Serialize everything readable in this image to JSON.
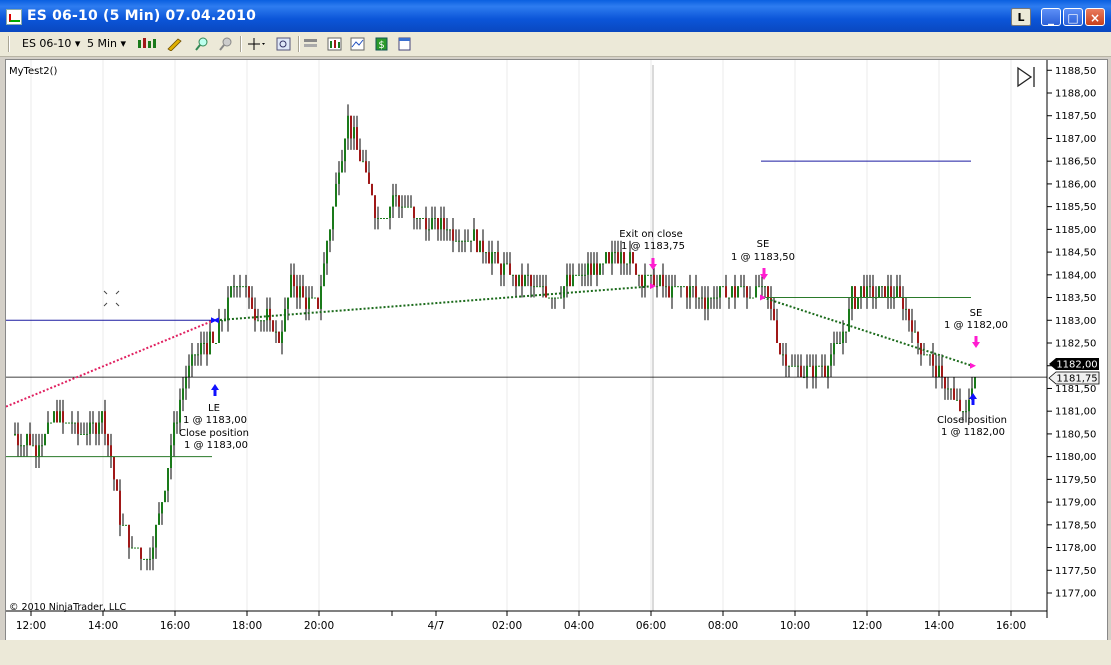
{
  "window": {
    "title": "ES 06-10 (5 Min)  07.04.2010",
    "btn_l": "L"
  },
  "toolbar": {
    "instrument": "ES 06-10",
    "interval": "5 Min"
  },
  "chart": {
    "indicator_label": "MyTest2()",
    "copyright": "© 2010 NinjaTrader, LLC",
    "y_ticks": [
      "1188,50",
      "1188,00",
      "1187,50",
      "1187,00",
      "1186,50",
      "1186,00",
      "1185,50",
      "1185,00",
      "1184,50",
      "1184,00",
      "1183,50",
      "1183,00",
      "1182,50",
      "1182,00",
      "1181,50",
      "1181,00",
      "1180,50",
      "1180,00",
      "1179,50",
      "1179,00",
      "1178,50",
      "1178,00",
      "1177,50",
      "1177,00"
    ],
    "x_ticks": [
      "12:00",
      "14:00",
      "16:00",
      "18:00",
      "20:00",
      "4/7",
      "02:00",
      "04:00",
      "06:00",
      "08:00",
      "10:00",
      "12:00",
      "14:00",
      "16:00"
    ],
    "price_flag_current": "1182,00",
    "price_flag_line": "1181,75",
    "annotations": {
      "le": "LE",
      "le_price": "1 @ 1183,00",
      "close_pos1": "Close position",
      "close_pos1_price": "1 @ 1183,00",
      "exit_close": "Exit on close",
      "exit_close_price": "1 @ 1183,75",
      "se1": "SE",
      "se1_price": "1 @ 1183,50",
      "se2": "SE",
      "se2_price": "1 @ 1182,00",
      "close_pos2": "Close position",
      "close_pos2_price": "1 @ 1182,00"
    }
  },
  "colors": {
    "up_bar": "#1a7a1a",
    "down_bar": "#a01818",
    "long_marker": "#1010ff",
    "short_marker": "#ff1cd0",
    "dotted_red": "#e02060",
    "dotted_green": "#1a6a1a",
    "ma_green": "#2a7a2a",
    "blue_line": "#1a1aa0"
  }
}
